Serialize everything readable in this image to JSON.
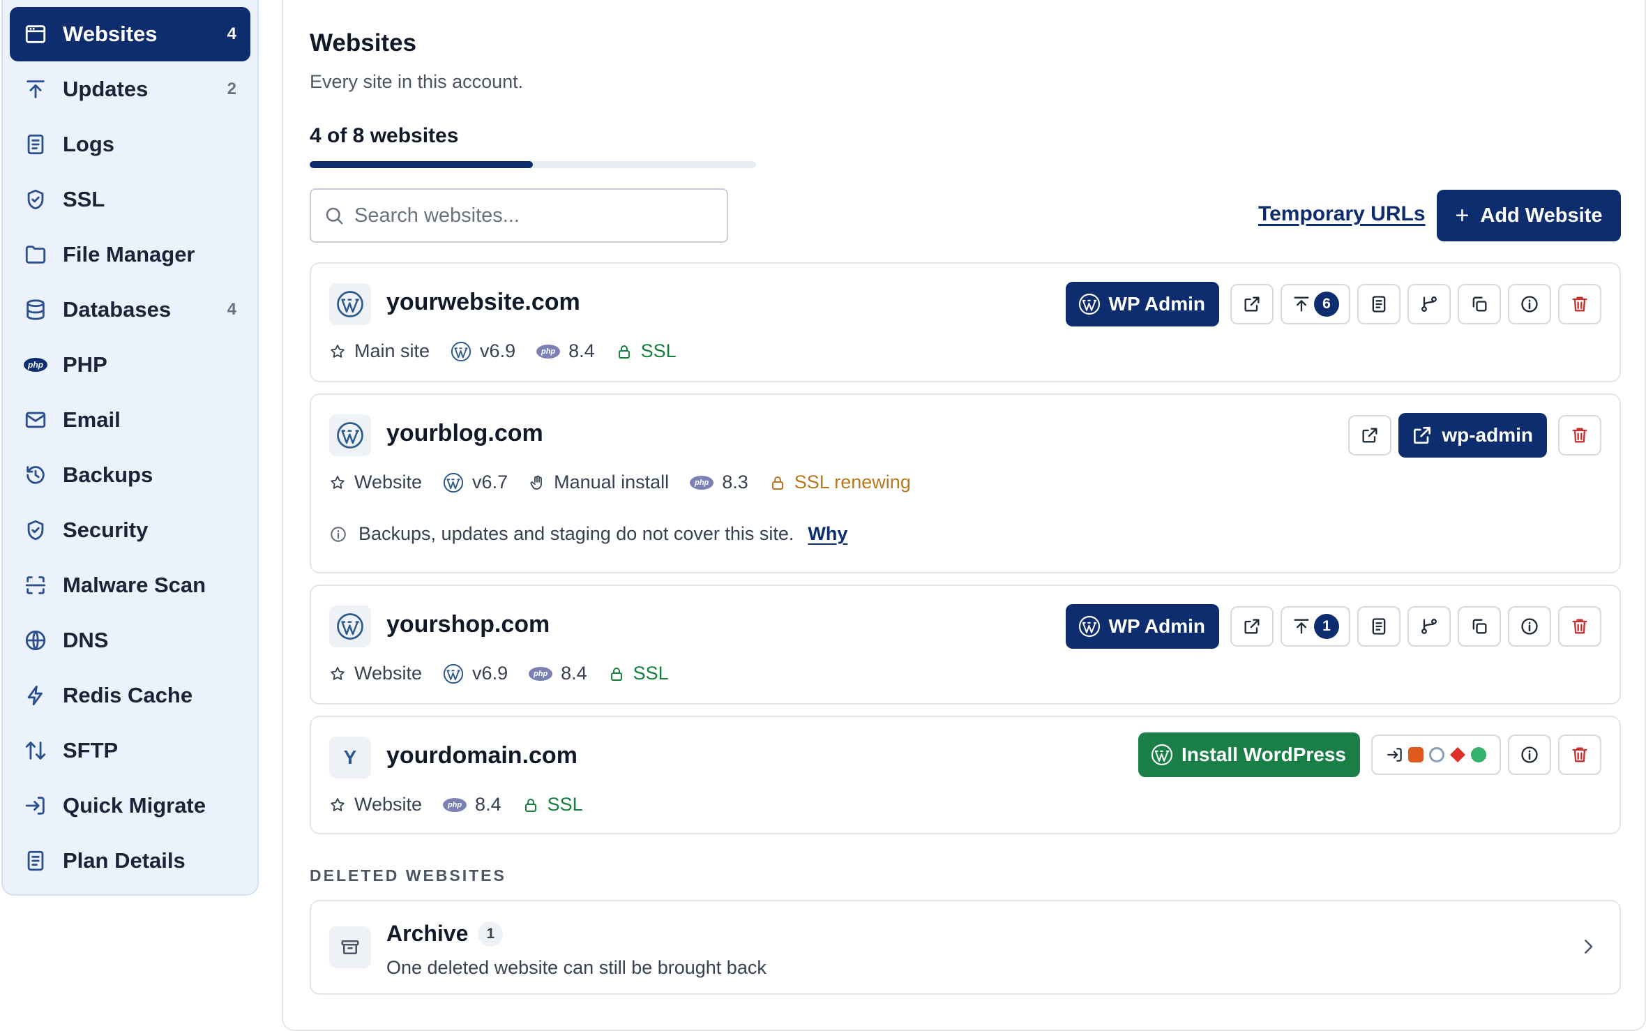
{
  "sidebar": {
    "items": [
      {
        "label": "Websites",
        "count": "4",
        "icon": "browser-icon",
        "active": true
      },
      {
        "label": "Updates",
        "count": "2",
        "icon": "upload-icon"
      },
      {
        "label": "Logs",
        "count": "",
        "icon": "file-icon"
      },
      {
        "label": "SSL",
        "count": "",
        "icon": "shield-check-icon"
      },
      {
        "label": "File Manager",
        "count": "",
        "icon": "folder-icon"
      },
      {
        "label": "Databases",
        "count": "4",
        "icon": "database-icon"
      },
      {
        "label": "PHP",
        "count": "",
        "icon": "php-icon"
      },
      {
        "label": "Email",
        "count": "",
        "icon": "mail-icon"
      },
      {
        "label": "Backups",
        "count": "",
        "icon": "history-icon"
      },
      {
        "label": "Security",
        "count": "",
        "icon": "shield-icon"
      },
      {
        "label": "Malware Scan",
        "count": "",
        "icon": "scan-icon"
      },
      {
        "label": "DNS",
        "count": "",
        "icon": "globe-icon"
      },
      {
        "label": "Redis Cache",
        "count": "",
        "icon": "bolt-icon"
      },
      {
        "label": "SFTP",
        "count": "",
        "icon": "transfer-icon"
      },
      {
        "label": "Quick Migrate",
        "count": "",
        "icon": "login-icon"
      },
      {
        "label": "Plan Details",
        "count": "",
        "icon": "receipt-icon"
      }
    ]
  },
  "header": {
    "title": "Websites",
    "subtitle": "Every site in this account.",
    "count_text": "4 of 8 websites",
    "progress_fraction": 0.5
  },
  "toolbar": {
    "search_placeholder": "Search websites...",
    "temp_urls_label": "Temporary URLs",
    "add_label": "Add Website",
    "add_plus": "+"
  },
  "sites": [
    {
      "name": "yourwebsite.com",
      "role": "Main site",
      "wp_version": "v6.9",
      "php_version": "8.4",
      "ssl": "SSL",
      "wp_admin_label": "WP Admin",
      "updates": "6"
    },
    {
      "name": "yourblog.com",
      "role": "Website",
      "wp_version": "v6.7",
      "install": "Manual install",
      "php_version": "8.3",
      "ssl": "SSL renewing",
      "wp_admin_label": "wp-admin",
      "notice": "Backups, updates and staging do not cover this site.",
      "notice_link": "Why"
    },
    {
      "name": "yourshop.com",
      "role": "Website",
      "wp_version": "v6.9",
      "php_version": "8.4",
      "ssl": "SSL",
      "wp_admin_label": "WP Admin",
      "updates": "1"
    },
    {
      "name": "yourdomain.com",
      "initial": "Y",
      "role": "Website",
      "php_version": "8.4",
      "ssl": "SSL",
      "install_label": "Install WordPress"
    }
  ],
  "deleted": {
    "section_label": "DELETED WEBSITES",
    "title": "Archive",
    "count": "1",
    "subtitle": "One deleted website can still be brought back"
  },
  "php_badge_text": "php",
  "colors": {
    "primary": "#0d2d6e",
    "success": "#15803d",
    "warning": "#b7791f",
    "danger": "#c53030",
    "install_green": "#1a7f46"
  }
}
